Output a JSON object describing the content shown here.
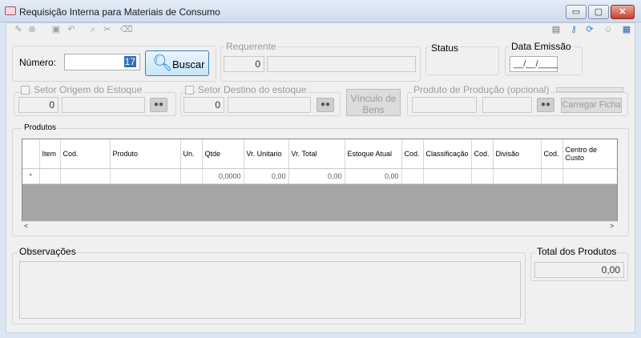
{
  "window": {
    "title": "Requisição Interna para Materiais de Consumo",
    "buttons": {
      "minimize": "▭",
      "maximize": "▢",
      "close": "✕"
    }
  },
  "toolbar": {
    "left_icons": [
      "edit-icon",
      "cancel-icon",
      "save-icon",
      "undo-icon",
      "search-icon",
      "tools-icon",
      "eraser-icon"
    ],
    "right_icons": [
      "window-icon",
      "key-icon",
      "refresh-icon",
      "user-icon",
      "exit-icon"
    ]
  },
  "numero": {
    "label": "Número:",
    "value": "17"
  },
  "buscar": {
    "label": "Buscar"
  },
  "requerente": {
    "label": "Requerente",
    "code": "0",
    "name": ""
  },
  "status": {
    "label": "Status",
    "value": ""
  },
  "data_emissao": {
    "label": "Data Emissão",
    "value": "__/__/____"
  },
  "setor_origem": {
    "label": "Setor Origem do Estoque",
    "code": "0",
    "name": ""
  },
  "setor_destino": {
    "label": "Setor Destino do estoque",
    "code": "0",
    "name": ""
  },
  "vinculo": {
    "label_line1": "Vínculo de",
    "label_line2": "Bens"
  },
  "producao": {
    "label": "Produto de Produção (opcional)",
    "carregar": "Carregar Ficha"
  },
  "produtos": {
    "label": "Produtos",
    "columns": [
      {
        "label": ""
      },
      {
        "label": "Item"
      },
      {
        "label": "Cod."
      },
      {
        "label": "Produto"
      },
      {
        "label": "Un."
      },
      {
        "label": "Qtde"
      },
      {
        "label": "Vr. Unitario"
      },
      {
        "label": "Vr. Total"
      },
      {
        "label": "Estoque Atual"
      },
      {
        "label": "Cod."
      },
      {
        "label": "Classificação"
      },
      {
        "label": "Cod."
      },
      {
        "label": "Divisão"
      },
      {
        "label": "Cod."
      },
      {
        "label": "Centro de Custo"
      }
    ],
    "new_row": {
      "marker": "*",
      "qtde": "0,0000",
      "vr_unitario": "0,00",
      "vr_total": "0,00",
      "estoque": "0,00"
    }
  },
  "observacoes": {
    "label": "Observações"
  },
  "total": {
    "label": "Total dos Produtos",
    "value": "0,00"
  }
}
